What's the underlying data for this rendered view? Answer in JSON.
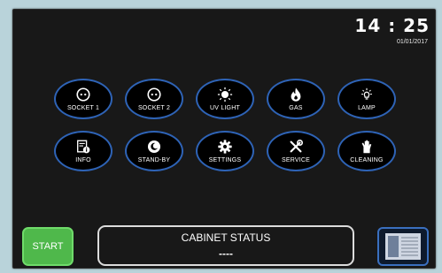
{
  "clock": {
    "time": "14 : 25",
    "date": "01/01/2017"
  },
  "tiles_row1": [
    {
      "label": "SOCKET 1",
      "icon": "socket-icon"
    },
    {
      "label": "SOCKET 2",
      "icon": "socket-icon"
    },
    {
      "label": "UV LIGHT",
      "icon": "uv-light-icon"
    },
    {
      "label": "GAS",
      "icon": "flame-icon"
    },
    {
      "label": "LAMP",
      "icon": "lamp-icon"
    }
  ],
  "tiles_row2": [
    {
      "label": "INFO",
      "icon": "info-icon"
    },
    {
      "label": "STAND-BY",
      "icon": "standby-icon"
    },
    {
      "label": "SETTINGS",
      "icon": "gear-icon"
    },
    {
      "label": "SERVICE",
      "icon": "tools-icon"
    },
    {
      "label": "CLEANING",
      "icon": "glove-icon"
    }
  ],
  "footer": {
    "start_label": "START",
    "status_title": "CABINET STATUS",
    "status_value": "----"
  },
  "colors": {
    "background": "#181818",
    "tile_border": "#2e63b6",
    "start_green": "#4fb84b",
    "frame": "#b9d3da"
  }
}
